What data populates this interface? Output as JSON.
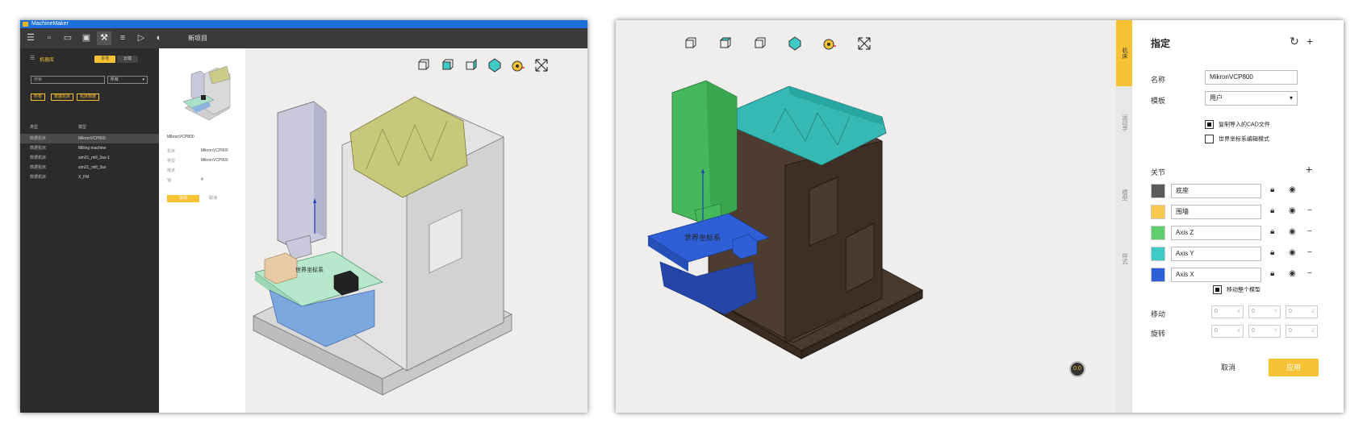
{
  "window1": {
    "title": "MachineMaker",
    "project_label": "新项目",
    "left_panel": {
      "heading": "机器库",
      "seg_local": "本地",
      "seg_cloud": "云端",
      "search_placeholder": "搜索",
      "filter_value": "所有",
      "chips": [
        "所有",
        "数据机床",
        "机床数据"
      ],
      "col_type": "类型",
      "col_model": "模型",
      "rows": [
        {
          "type": "数据机床",
          "model": "MikronVCP800"
        },
        {
          "type": "数据机床",
          "model": "Milling machine"
        },
        {
          "type": "数据机床",
          "model": "sim21_mill_3ax-1"
        },
        {
          "type": "数据机床",
          "model": "sim21_mill_3ax"
        },
        {
          "type": "数据机床",
          "model": "X_FM"
        }
      ]
    },
    "model_panel": {
      "name": "MikronVCP800",
      "props": [
        {
          "k": "机床",
          "v": "MikronVCP800"
        },
        {
          "k": "类型",
          "v": "MikronVCP800"
        },
        {
          "k": "描述",
          "v": ""
        },
        {
          "k": "轴",
          "v": "4"
        }
      ],
      "add_label": "添加",
      "cancel_label": "取消"
    }
  },
  "window2": {
    "gizmo_label": "0.0",
    "tabs": [
      "机床",
      "运动学",
      "模型",
      "样式"
    ],
    "panel": {
      "title": "指定",
      "name_label": "名称",
      "name_value": "MikronVCP800",
      "template_label": "模板",
      "template_value": "用户",
      "chk_copy": "复制导入的CAD文件",
      "chk_world": "世界坐标系编辑模式",
      "joints_label": "关节",
      "joints": [
        {
          "name": "底座",
          "color": "#5a5a5a"
        },
        {
          "name": "围墙",
          "color": "#f7c94f"
        },
        {
          "name": "Axis Z",
          "color": "#5fcf6e"
        },
        {
          "name": "Axis Y",
          "color": "#3ecbc6"
        },
        {
          "name": "Axis X",
          "color": "#2f5fd6"
        }
      ],
      "move_whole": "移动整个模型",
      "move_label": "移动",
      "rotate_label": "旋转",
      "move_values": [
        "0",
        "0",
        "0"
      ],
      "rotate_values": [
        "0",
        "0",
        "0"
      ],
      "axis_x": "X",
      "axis_y": "Y",
      "axis_z": "Z",
      "cancel_label": "取消",
      "apply_label": "应用"
    },
    "world_label": "世界坐标系"
  },
  "world_label_1": "世界坐标系",
  "colors": {
    "accent": "#f7c233",
    "dark_panel": "#2b2b2b",
    "title_blue": "#1b6fd9"
  }
}
